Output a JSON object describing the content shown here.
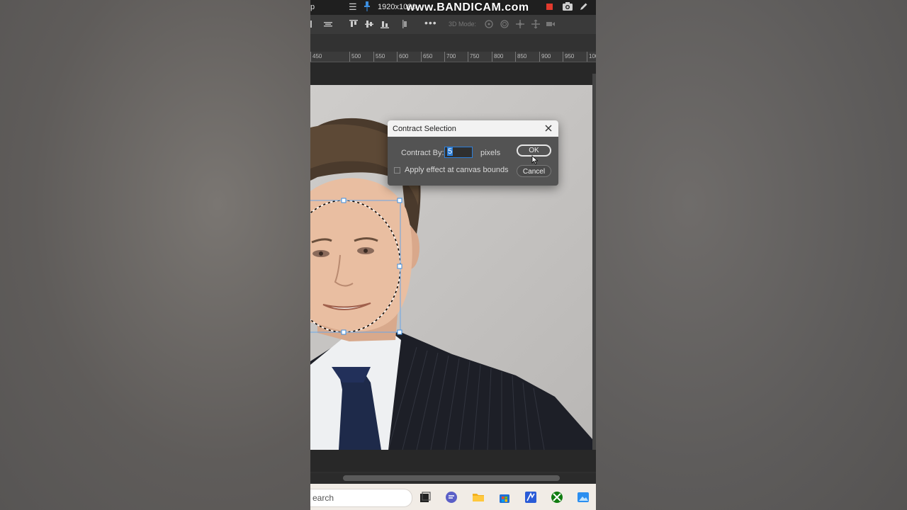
{
  "titlebar": {
    "app_fragment": "p",
    "resolution": "1920x1080",
    "watermark": "www.BANDICAM.com"
  },
  "optionsbar": {
    "mode_3d_label": "3D Mode:",
    "more_label": "•••"
  },
  "ruler": {
    "ticks": [
      "450",
      "500",
      "550",
      "600",
      "650",
      "700",
      "750",
      "800",
      "850",
      "900",
      "950",
      "100"
    ]
  },
  "dialog": {
    "title": "Contract Selection",
    "contract_by_label": "Contract By:",
    "contract_by_value": "5",
    "units": "pixels",
    "apply_checkbox_label": "Apply effect at canvas bounds",
    "apply_checked": false,
    "ok_label": "OK",
    "cancel_label": "Cancel"
  },
  "taskbar": {
    "search_text": "earch",
    "icons": [
      "task-view-icon",
      "chat-icon",
      "file-explorer-icon",
      "store-icon",
      "sketch-app-icon",
      "xbox-icon",
      "photos-icon"
    ]
  },
  "colors": {
    "accent_blue": "#2d7fd9",
    "recording_red": "#e23a2d",
    "dialog_bg": "#535353",
    "app_dark": "#2f2f2f"
  }
}
